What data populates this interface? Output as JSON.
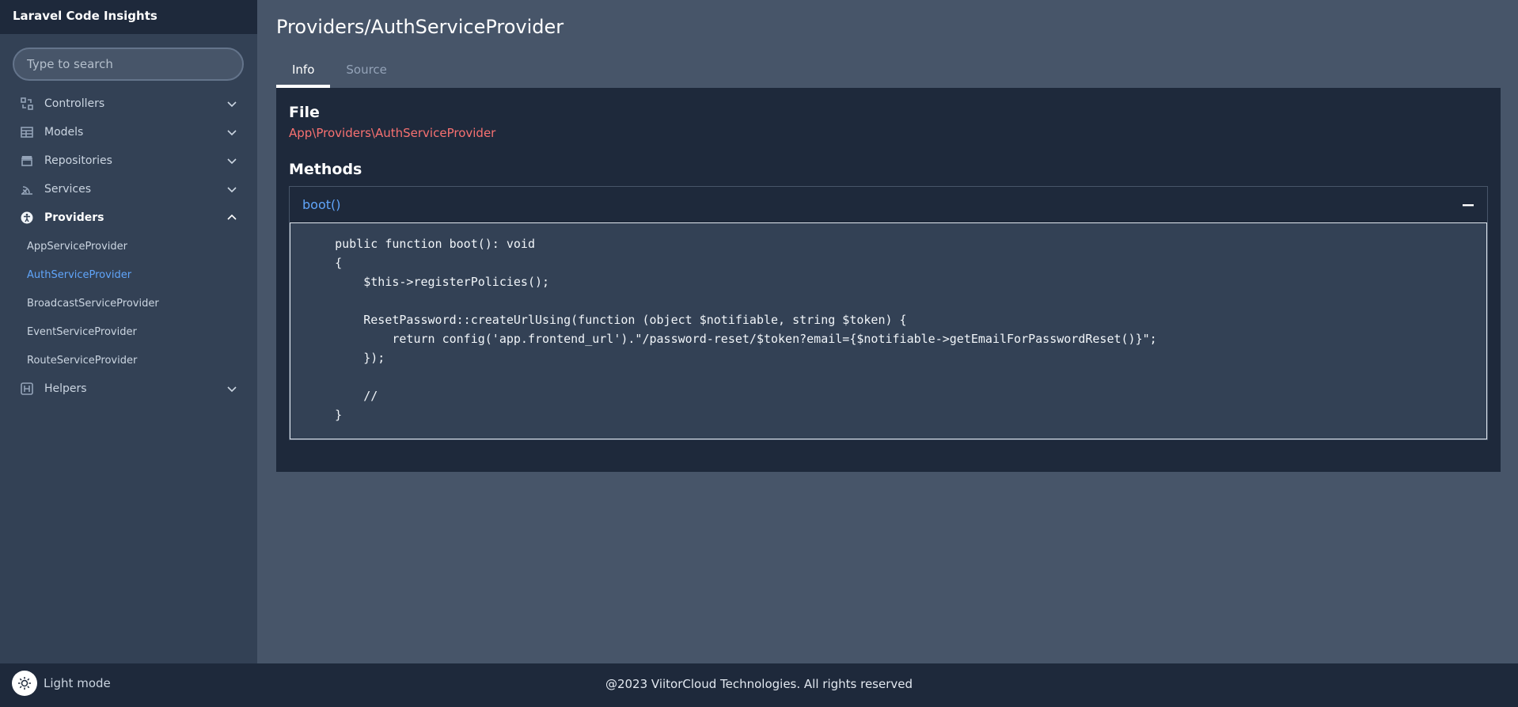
{
  "app": {
    "title": "Laravel Code Insights"
  },
  "search": {
    "placeholder": "Type to search"
  },
  "sidebar": {
    "items": [
      {
        "label": "Controllers",
        "icon": "controllers-icon"
      },
      {
        "label": "Models",
        "icon": "table-icon"
      },
      {
        "label": "Repositories",
        "icon": "store-icon"
      },
      {
        "label": "Services",
        "icon": "signal-icon"
      },
      {
        "label": "Providers",
        "icon": "accessibility-icon",
        "expanded": true
      },
      {
        "label": "Helpers",
        "icon": "helpers-icon"
      }
    ],
    "providers": [
      "AppServiceProvider",
      "AuthServiceProvider",
      "BroadcastServiceProvider",
      "EventServiceProvider",
      "RouteServiceProvider"
    ],
    "current_provider": "AuthServiceProvider"
  },
  "page": {
    "title": "Providers/AuthServiceProvider",
    "tabs": [
      "Info",
      "Source"
    ],
    "active_tab": "Info"
  },
  "info": {
    "file_heading": "File",
    "file_path": "App\\Providers\\AuthServiceProvider",
    "methods_heading": "Methods",
    "methods": [
      {
        "name": "boot()",
        "expanded": true,
        "code": "    public function boot(): void\n    {\n        $this->registerPolicies();\n\n        ResetPassword::createUrlUsing(function (object $notifiable, string $token) {\n            return config('app.frontend_url').\"/password-reset/$token?email={$notifiable->getEmailForPasswordReset()}\";\n        });\n\n        //\n    }"
      }
    ]
  },
  "footer": {
    "mode_label": "Light mode",
    "copyright": "@2023 ViitorCloud Technologies. All rights reserved"
  },
  "colors": {
    "sidebar_bg": "#334155",
    "main_bg": "#475569",
    "panel_bg": "#1e293b",
    "link_blue": "#60a5fa",
    "file_red": "#f87171"
  }
}
